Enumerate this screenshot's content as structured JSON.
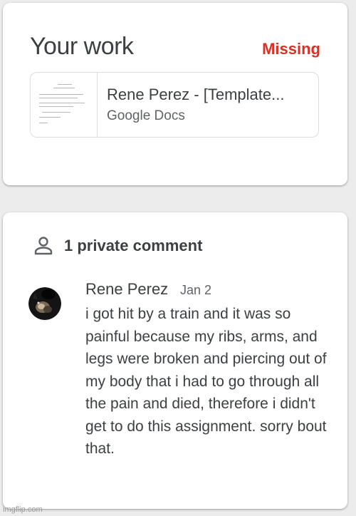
{
  "your_work": {
    "title": "Your work",
    "status": "Missing",
    "attachment": {
      "title": "Rene Perez - [Template...",
      "subtitle": "Google Docs"
    }
  },
  "comments": {
    "header": "1 private comment",
    "items": [
      {
        "author": "Rene Perez",
        "date": "Jan 2",
        "text": "i got hit by a train and it was so painful because my ribs, arms, and legs were broken and piercing out of my body that i had to go through all the pain and died, therefore i didn't get to do this assignment. sorry bout that."
      }
    ]
  },
  "watermark": "imgflip.com",
  "colors": {
    "missing": "#d93025",
    "text_primary": "#3c4043",
    "text_secondary": "#5f6368",
    "border": "#dadce0"
  },
  "icons": {
    "comment_header": "person-icon",
    "attachment": "document-thumbnail"
  }
}
